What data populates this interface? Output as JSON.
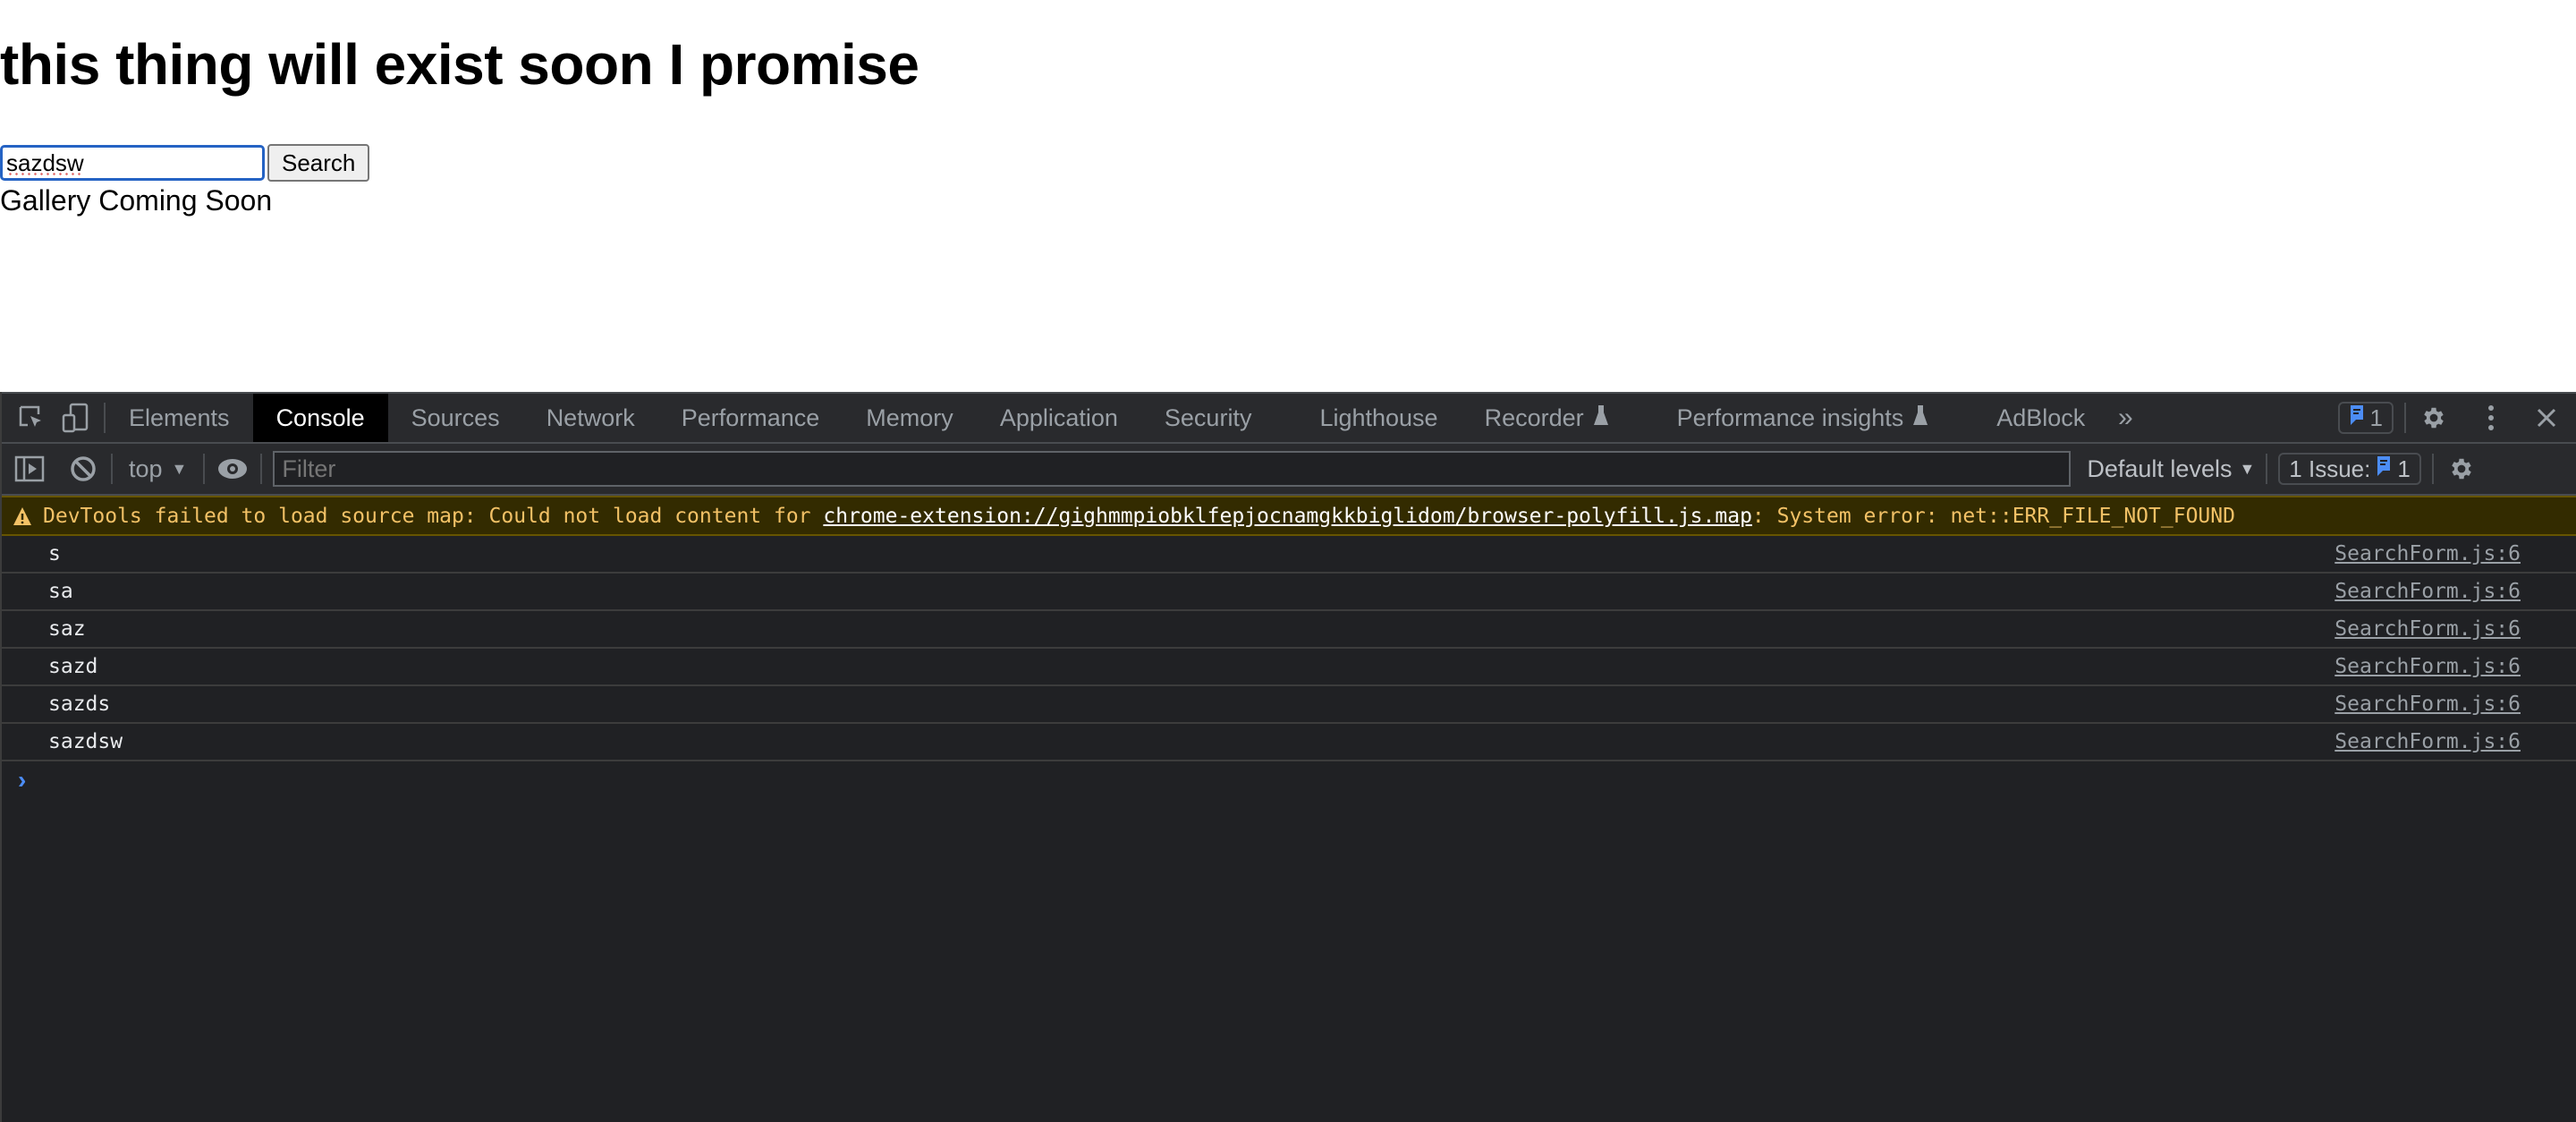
{
  "page": {
    "heading": "this thing will exist soon I promise",
    "search": {
      "value": "sazdsw",
      "button_label": "Search"
    },
    "gallery_text": "Gallery Coming Soon"
  },
  "devtools": {
    "tabs": [
      {
        "label": "Elements",
        "active": false
      },
      {
        "label": "Console",
        "active": true
      },
      {
        "label": "Sources",
        "active": false
      },
      {
        "label": "Network",
        "active": false
      },
      {
        "label": "Performance",
        "active": false
      },
      {
        "label": "Memory",
        "active": false
      },
      {
        "label": "Application",
        "active": false
      },
      {
        "label": "Security",
        "active": false
      },
      {
        "label": "Lighthouse",
        "active": false
      },
      {
        "label": "Recorder",
        "active": false,
        "experimental": true
      },
      {
        "label": "Performance insights",
        "active": false,
        "experimental": true
      },
      {
        "label": "AdBlock",
        "active": false
      }
    ],
    "more_tabs_icon": "chevrons-right-icon",
    "issues_badge_count": "1",
    "toolbar": {
      "context": "top",
      "filter_placeholder": "Filter",
      "levels": "Default levels",
      "issues_label": "1 Issue:",
      "issues_count": "1"
    },
    "warning": {
      "prefix": "DevTools failed to load source map: Could not load content for ",
      "link": "chrome-extension://gighmmpiobklfepjocnamgkkbiglidom/browser-polyfill.js.map",
      "suffix": ": System error: net::ERR_FILE_NOT_FOUND"
    },
    "logs": [
      {
        "text": "s",
        "source": "SearchForm.js:6"
      },
      {
        "text": "sa",
        "source": "SearchForm.js:6"
      },
      {
        "text": "saz",
        "source": "SearchForm.js:6"
      },
      {
        "text": "sazd",
        "source": "SearchForm.js:6"
      },
      {
        "text": "sazds",
        "source": "SearchForm.js:6"
      },
      {
        "text": "sazdsw",
        "source": "SearchForm.js:6"
      }
    ],
    "colors": {
      "accent_blue": "#4c8df6",
      "warning_text": "#f2c166",
      "warning_bg": "#332b00"
    }
  }
}
